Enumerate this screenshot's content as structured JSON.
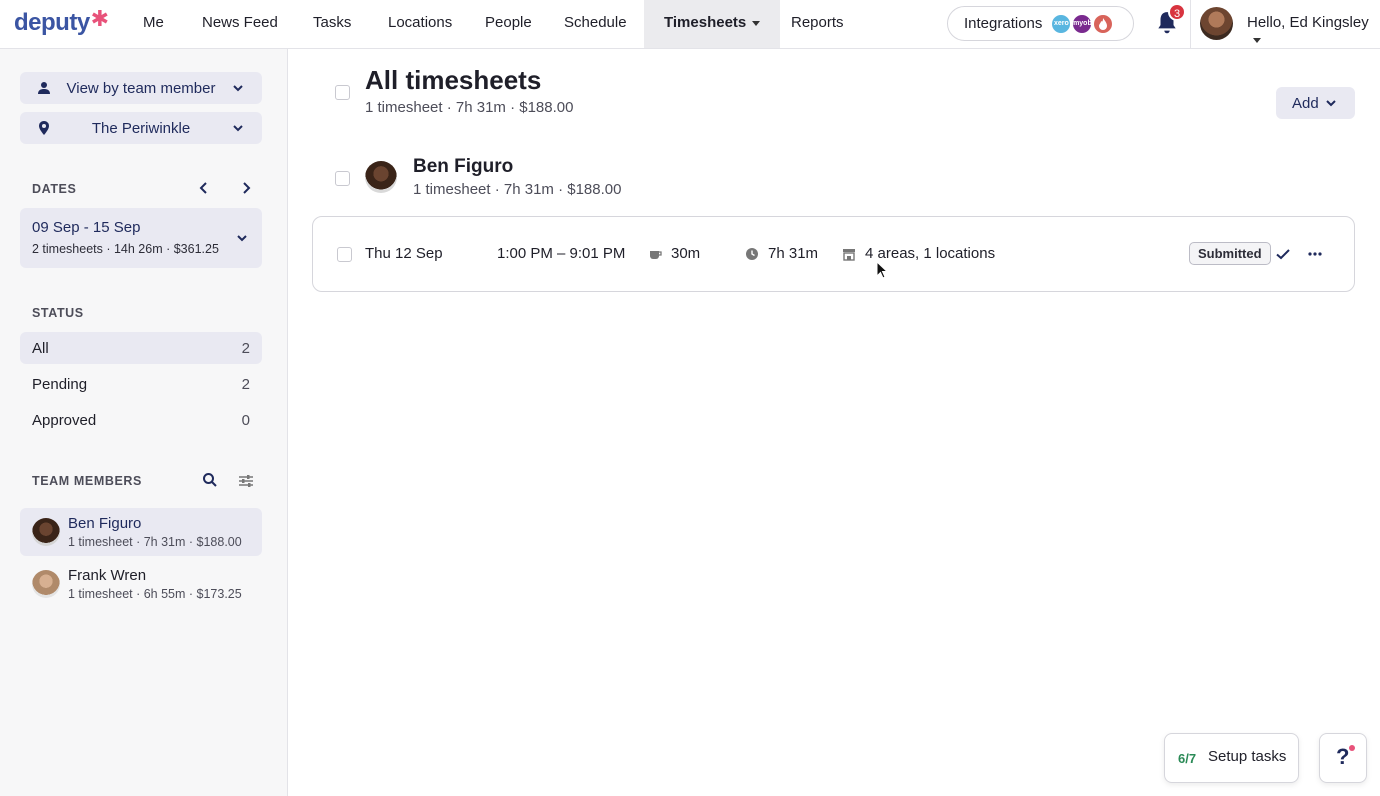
{
  "brand": {
    "logo_text": "deputy",
    "logo_mark": "✱",
    "accent": "#e8527a",
    "primary": "#1f2a5c"
  },
  "nav": {
    "items": [
      "Me",
      "News Feed",
      "Tasks",
      "Locations",
      "People",
      "Schedule",
      "Timesheets",
      "Reports"
    ],
    "active": "Timesheets",
    "integrations_label": "Integrations",
    "integration_logos": [
      "xero",
      "myob",
      "fire"
    ],
    "notifications_count": "3",
    "greeting": "Hello, Ed Kingsley"
  },
  "sidebar": {
    "view_by": "View by team member",
    "location": "The Periwinkle",
    "dates_title": "DATES",
    "date_range": "09 Sep - 15 Sep",
    "date_meta": "2 timesheets · 14h 26m · $361.25",
    "status_title": "STATUS",
    "status": [
      {
        "label": "All",
        "count": "2"
      },
      {
        "label": "Pending",
        "count": "2"
      },
      {
        "label": "Approved",
        "count": "0"
      }
    ],
    "team_title": "TEAM MEMBERS",
    "members": [
      {
        "name": "Ben Figuro",
        "meta": "1 timesheet · 7h 31m · $188.00"
      },
      {
        "name": "Frank Wren",
        "meta": "1 timesheet · 6h 55m · $173.25"
      }
    ]
  },
  "main": {
    "title": "All timesheets",
    "meta": "1 timesheet · 7h 31m · $188.00",
    "add_label": "Add",
    "employee": {
      "name": "Ben Figuro",
      "meta": "1 timesheet · 7h 31m · $188.00"
    },
    "timesheet": {
      "date": "Thu 12 Sep",
      "time": "1:00 PM – 9:01 PM",
      "break": "30m",
      "duration": "7h 31m",
      "areas": "4 areas, 1 locations",
      "status": "Submitted"
    }
  },
  "footer": {
    "setup_fraction": "6/7",
    "setup_label": "Setup tasks",
    "help_label": "?"
  }
}
